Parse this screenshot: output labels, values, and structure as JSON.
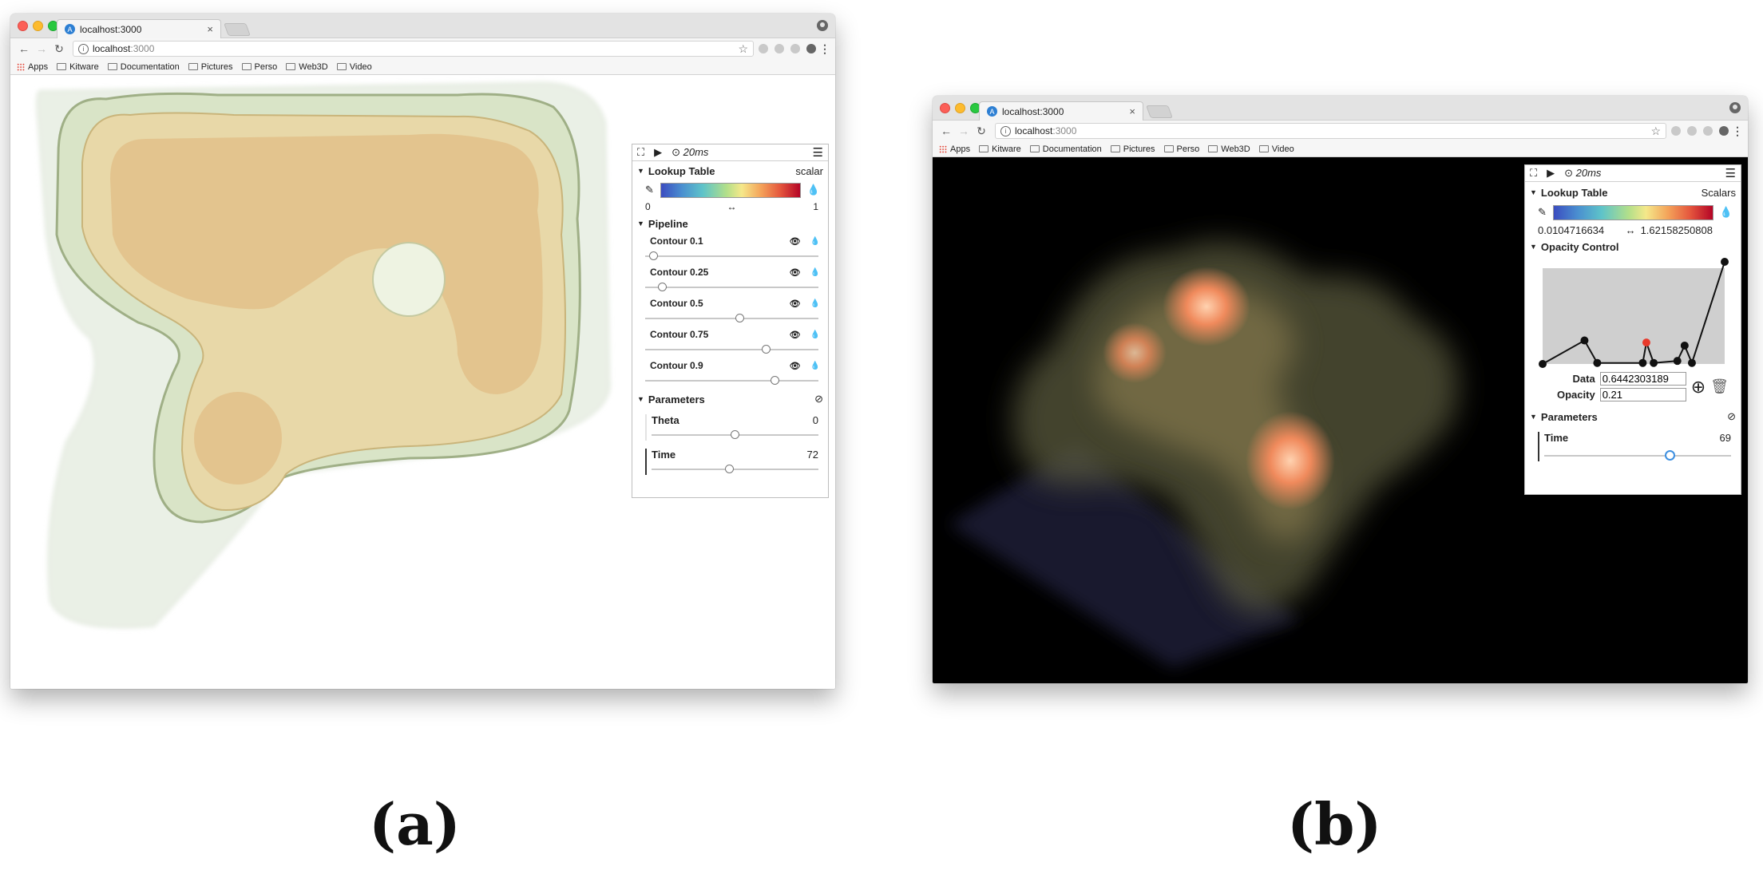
{
  "browser": {
    "tab_title": "localhost:3000",
    "tab_close": "×",
    "favicon": "A",
    "url_host": "localhost",
    "url_rest": ":3000",
    "nav": {
      "back": "←",
      "forward": "→",
      "reload": "↻"
    },
    "star": "☆",
    "menu": "⋮",
    "info": "i",
    "bookmarks": [
      "Apps",
      "Kitware",
      "Documentation",
      "Pictures",
      "Perso",
      "Web3D",
      "Video"
    ]
  },
  "colors": {
    "lut_low": "#3b4cc0",
    "lut_high": "#b40426",
    "bg_a": "#ffffff",
    "bg_b": "#000000",
    "highlight_point": "#e8392b"
  },
  "icons": {
    "fullscreen": "fullscreen-icon",
    "play": "play-icon",
    "clock": "clock-icon",
    "menu": "hamburger-icon",
    "pencil": "pencil-icon",
    "drop": "drop-icon",
    "eye": "eye-icon",
    "reset": "reset-icon",
    "add": "add-icon",
    "trash": "trash-icon"
  },
  "panel_a": {
    "fps": "20ms",
    "lookup_table": {
      "label": "Lookup Table",
      "field": "scalar",
      "min": "0",
      "max": "1",
      "arrow": "↔"
    },
    "pipeline": {
      "label": "Pipeline",
      "contours": [
        {
          "label": "Contour 0.1",
          "value": 0.05
        },
        {
          "label": "Contour 0.25",
          "value": 0.1
        },
        {
          "label": "Contour 0.5",
          "value": 0.55
        },
        {
          "label": "Contour 0.75",
          "value": 0.7
        },
        {
          "label": "Contour 0.9",
          "value": 0.75
        }
      ]
    },
    "parameters": {
      "label": "Parameters",
      "theta": {
        "label": "Theta",
        "value": "0",
        "fraction": 0.5
      },
      "time": {
        "label": "Time",
        "value": "72",
        "fraction": 0.47
      }
    }
  },
  "panel_b": {
    "fps": "20ms",
    "lookup_table": {
      "label": "Lookup Table",
      "field": "Scalars",
      "min": "0.0104716634",
      "max": "1.62158250808",
      "arrow": "↔"
    },
    "opacity_control": {
      "label": "Opacity Control",
      "points": [
        {
          "x": 0.0,
          "y": 0.0
        },
        {
          "x": 0.23,
          "y": 0.23
        },
        {
          "x": 0.3,
          "y": 0.01
        },
        {
          "x": 0.55,
          "y": 0.01
        },
        {
          "x": 0.57,
          "y": 0.21,
          "selected": true
        },
        {
          "x": 0.61,
          "y": 0.01
        },
        {
          "x": 0.74,
          "y": 0.03
        },
        {
          "x": 0.78,
          "y": 0.18
        },
        {
          "x": 0.82,
          "y": 0.01
        },
        {
          "x": 1.0,
          "y": 1.0
        }
      ],
      "data_label": "Data",
      "data_value": "0.6442303189",
      "opacity_label": "Opacity",
      "opacity_value": "0.21"
    },
    "parameters": {
      "label": "Parameters",
      "time": {
        "label": "Time",
        "value": "69",
        "fraction": 0.67
      }
    }
  },
  "captions": {
    "a": "(a)",
    "b": "(b)"
  }
}
